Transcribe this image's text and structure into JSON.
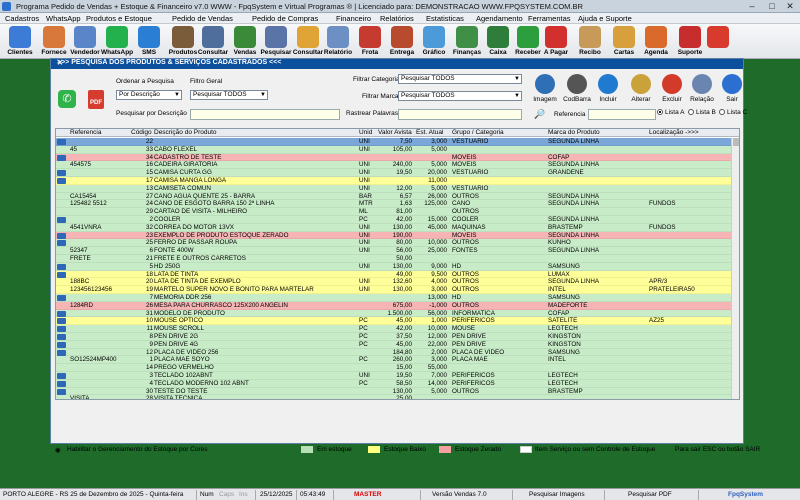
{
  "titlebar": {
    "title": "Programa Pedido de Vendas + Estoque & Financeiro v7.0 WWW - FpqSystem e Virtual Programas ® | Licenciado para: DEMONSTRACAO WWW.FPQSYSTEM.COM.BR"
  },
  "menu": [
    "Cadastros",
    "WhatsApp",
    "Produtos e Estoque",
    "Pedido de Vendas",
    "Pedido de Compras",
    "Financeiro",
    "Relatórios",
    "Estatisticas",
    "Agendamento",
    "Ferramentas",
    "Ajuda e Suporte"
  ],
  "toolbar": [
    {
      "label": "Clientes",
      "icon": "clients-icon",
      "color": "#3c7bd6"
    },
    {
      "label": "Fornece",
      "icon": "supplier-icon",
      "color": "#d8783a"
    },
    {
      "label": "Vendedor",
      "icon": "seller-icon",
      "color": "#5a86c9"
    },
    {
      "label": "WhatsApp",
      "icon": "whatsapp-icon",
      "color": "#22b14c"
    },
    {
      "label": "SMS",
      "icon": "sms-icon",
      "color": "#2a7fd4"
    },
    {
      "label": "Produtos",
      "icon": "products-icon",
      "color": "#7a5b3a"
    },
    {
      "label": "Consultar",
      "icon": "consult-icon",
      "color": "#4f6e9c"
    },
    {
      "label": "Vendas",
      "icon": "cart-icon",
      "color": "#3a8a3a"
    },
    {
      "label": "Pesquisar",
      "icon": "search-doc-icon",
      "color": "#5b74a8"
    },
    {
      "label": "Consultar",
      "icon": "consult-folder-icon",
      "color": "#e0a436"
    },
    {
      "label": "Relatório",
      "icon": "report-icon",
      "color": "#6c8fc4"
    },
    {
      "label": "Frota",
      "icon": "truck-icon",
      "color": "#c53b2f"
    },
    {
      "label": "Entrega",
      "icon": "delivery-icon",
      "color": "#b84a2e"
    },
    {
      "label": "Gráfico",
      "icon": "chart-icon",
      "color": "#4c9ad8"
    },
    {
      "label": "Finanças",
      "icon": "finance-icon",
      "color": "#3f8f47"
    },
    {
      "label": "Caixa",
      "icon": "cashier-icon",
      "color": "#2f7d3a"
    },
    {
      "label": "Receber",
      "icon": "receive-icon",
      "color": "#2c9e3e"
    },
    {
      "label": "A Pagar",
      "icon": "pay-icon",
      "color": "#d22f2f"
    },
    {
      "label": "Recibo",
      "icon": "receipt-icon",
      "color": "#c79a5a"
    },
    {
      "label": "Cartas",
      "icon": "letters-icon",
      "color": "#d7a03c"
    },
    {
      "label": "Agenda",
      "icon": "calendar-icon",
      "color": "#d96a2b"
    },
    {
      "label": "Suporte",
      "icon": "support-icon",
      "color": "#c72d2d"
    },
    {
      "label": "",
      "icon": "exit-icon",
      "color": "#d83a2e"
    }
  ],
  "window": {
    "title": ">>>  PESQUISA DOS PRODUTOS & SERVIÇOS CADASTRADOS  <<<",
    "ordenar_label": "Ordenar a Pesquisa",
    "ordenar_value": "Por Descrição",
    "filtro_geral_label": "Filtro Geral",
    "filtro_geral_value": "Pesquisar TODOS",
    "filtrar_categoria_label": "Filtrar Categoria",
    "filtrar_categoria_value": "Pesquisar TODOS",
    "filtrar_marca_label": "Filtrar Marca",
    "filtrar_marca_value": "Pesquisar TODOS",
    "pesquisar_descricao_label": "Pesquisar por Descrição",
    "rastrear_label": "Rastrear Palavras",
    "referencia_label": "Referencia",
    "buttons": [
      {
        "label": "Imagem",
        "icon": "image-icon",
        "color": "#2f6fb6"
      },
      {
        "label": "CodBarra",
        "icon": "barcode-icon",
        "color": "#555555"
      },
      {
        "label": "Incluir",
        "icon": "add-icon",
        "color": "#1f7ad0"
      },
      {
        "label": "Alterar",
        "icon": "edit-icon",
        "color": "#c9a23a"
      },
      {
        "label": "Excluir",
        "icon": "delete-icon",
        "color": "#d23a2a"
      },
      {
        "label": "Relação",
        "icon": "list-icon",
        "color": "#6a86b0"
      },
      {
        "label": "Sair",
        "icon": "exit-arrow-icon",
        "color": "#2b6fd0"
      }
    ],
    "radios": [
      {
        "label": "Lista A",
        "selected": true
      },
      {
        "label": "Lista B",
        "selected": false
      },
      {
        "label": "Lista C",
        "selected": false
      }
    ]
  },
  "table": {
    "columns": [
      "Referencia",
      "Código",
      "Descrição do Produto",
      "Unid",
      "Valor Avista",
      "Est. Atual",
      "Grupo / Categoria",
      "Marca do Produto",
      "Localização  ->>>"
    ],
    "rows": [
      {
        "mk": true,
        "ref": "",
        "cod": "22",
        "desc": "",
        "unid": "UNI",
        "valor": "7,50",
        "est": "3,000",
        "grupo": "VESTUARIO",
        "marca": "SEGUNDA LINHA",
        "loc": "",
        "status": "sel"
      },
      {
        "mk": false,
        "ref": "45",
        "cod": "33",
        "desc": "CABO FLEXEL",
        "unid": "UNI",
        "valor": "105,00",
        "est": "5,000",
        "grupo": "",
        "marca": "",
        "loc": "",
        "status": "ok"
      },
      {
        "mk": true,
        "ref": "",
        "cod": "34",
        "desc": "CADASTRO DE TESTE",
        "unid": "",
        "valor": "",
        "est": "",
        "grupo": "MOVEIS",
        "marca": "COFAP",
        "loc": "",
        "status": "zero"
      },
      {
        "mk": false,
        "ref": "454575",
        "cod": "16",
        "desc": "CADEIRA GIRATORIA",
        "unid": "UNI",
        "valor": "240,00",
        "est": "5,000",
        "grupo": "MOVEIS",
        "marca": "SEGUNDA LINHA",
        "loc": "",
        "status": "ok"
      },
      {
        "mk": true,
        "ref": "",
        "cod": "15",
        "desc": "CAMISA CURTA GG",
        "unid": "UNI",
        "valor": "19,50",
        "est": "20,000",
        "grupo": "VESTUARIO",
        "marca": "GRANDENE",
        "loc": "",
        "status": "ok"
      },
      {
        "mk": true,
        "ref": "",
        "cod": "17",
        "desc": "CAMISA MANGA LONGA",
        "unid": "UNI",
        "valor": "",
        "est": "11,000",
        "grupo": "",
        "marca": "",
        "loc": "",
        "status": "low"
      },
      {
        "mk": false,
        "ref": "",
        "cod": "13",
        "desc": "CAMISETA COMUN",
        "unid": "UNI",
        "valor": "12,00",
        "est": "5,000",
        "grupo": "VESTUARIO",
        "marca": "",
        "loc": "",
        "status": "ok"
      },
      {
        "mk": false,
        "ref": "CA15454",
        "cod": "27",
        "desc": "CANO AGUA QUENTE 25 - BARRA",
        "unid": "BAR",
        "valor": "6,57",
        "est": "26,000",
        "grupo": "OUTROS",
        "marca": "SEGUNDA LINHA",
        "loc": "",
        "status": "ok"
      },
      {
        "mk": false,
        "ref": "125482 5512",
        "cod": "24",
        "desc": "CANO DE ESGOTO BARRA 150 2ª LINHA",
        "unid": "MTR",
        "valor": "1,63",
        "est": "125,000",
        "grupo": "CANO",
        "marca": "SEGUNDA LINHA",
        "loc": "FUNDOS",
        "status": "ok"
      },
      {
        "mk": false,
        "ref": "",
        "cod": "29",
        "desc": "CARTAO DE VISITA - MILHEIRO",
        "unid": "ML",
        "valor": "81,00",
        "est": "",
        "grupo": "OUTROS",
        "marca": "",
        "loc": "",
        "status": "ok"
      },
      {
        "mk": true,
        "ref": "",
        "cod": "2",
        "desc": "COOLER",
        "unid": "PC",
        "valor": "42,00",
        "est": "15,000",
        "grupo": "COOLER",
        "marca": "SEGUNDA LINHA",
        "loc": "",
        "status": "ok"
      },
      {
        "mk": false,
        "ref": "4541VNRA",
        "cod": "32",
        "desc": "CORREA DO MOTOR 13VX",
        "unid": "UNI",
        "valor": "130,00",
        "est": "45,000",
        "grupo": "MAQUINAS",
        "marca": "BRASTEMP",
        "loc": "FUNDOS",
        "status": "ok"
      },
      {
        "mk": true,
        "ref": "",
        "cod": "23",
        "desc": "EXEMPLO DE PRODUTO ESTOQUE ZERADO",
        "unid": "UNI",
        "valor": "190,00",
        "est": "",
        "grupo": "MOVEIS",
        "marca": "SEGUNDA LINHA",
        "loc": "",
        "status": "zero"
      },
      {
        "mk": true,
        "ref": "",
        "cod": "25",
        "desc": "FERRO DE PASSAR ROUPA",
        "unid": "UNI",
        "valor": "80,00",
        "est": "10,000",
        "grupo": "OUTROS",
        "marca": "KUNHO",
        "loc": "",
        "status": "ok"
      },
      {
        "mk": false,
        "ref": "52347",
        "cod": "6",
        "desc": "FONTE 400W",
        "unid": "UNI",
        "valor": "56,00",
        "est": "25,000",
        "grupo": "FONTES",
        "marca": "SEGUNDA LINHA",
        "loc": "",
        "status": "ok"
      },
      {
        "mk": false,
        "ref": "FRETE",
        "cod": "21",
        "desc": "FRETE E OUTROS CARRETOS",
        "unid": "",
        "valor": "50,00",
        "est": "",
        "grupo": "",
        "marca": "",
        "loc": "",
        "status": "ok"
      },
      {
        "mk": true,
        "ref": "",
        "cod": "5",
        "desc": "HD 250G",
        "unid": "UNI",
        "valor": "130,00",
        "est": "9,000",
        "grupo": "HD",
        "marca": "SAMSUNG",
        "loc": "",
        "status": "ok"
      },
      {
        "mk": true,
        "ref": "",
        "cod": "18",
        "desc": "LATA DE TINTA",
        "unid": "",
        "valor": "49,00",
        "est": "9,500",
        "grupo": "OUTROS",
        "marca": "LUMAX",
        "loc": "",
        "status": "low"
      },
      {
        "mk": false,
        "ref": "188BC",
        "cod": "20",
        "desc": "LATA DE TINTA DE EXEMPLO",
        "unid": "UNI",
        "valor": "132,60",
        "est": "4,000",
        "grupo": "OUTROS",
        "marca": "SEGUNDA LINHA",
        "loc": "APR/3",
        "status": "low"
      },
      {
        "mk": false,
        "ref": "123456123456",
        "cod": "19",
        "desc": "MARTELO SUPER NOVO E BONITO PARA MARTELAR",
        "unid": "UNI",
        "valor": "130,00",
        "est": "3,000",
        "grupo": "OUTROS",
        "marca": "INTEL",
        "loc": "PRATELEIRA50",
        "status": "low"
      },
      {
        "mk": true,
        "ref": "",
        "cod": "7",
        "desc": "MEMORIA DDR 256",
        "unid": "",
        "valor": "",
        "est": "13,000",
        "grupo": "HD",
        "marca": "SAMSUNG",
        "loc": "",
        "status": "ok"
      },
      {
        "mk": false,
        "ref": "1284RD",
        "cod": "26",
        "desc": "MESA PARA CHURRASCO 125X200 ANGELIN",
        "unid": "",
        "valor": "675,00",
        "est": "-1,000",
        "grupo": "OUTROS",
        "marca": "MADEFORTE",
        "loc": "",
        "status": "zero"
      },
      {
        "mk": true,
        "ref": "",
        "cod": "31",
        "desc": "MODELO DE PRODUTO",
        "unid": "",
        "valor": "1.500,00",
        "est": "56,000",
        "grupo": "INFORMATICA",
        "marca": "COFAP",
        "loc": "",
        "status": "ok"
      },
      {
        "mk": true,
        "ref": "",
        "cod": "10",
        "desc": "MOUSE OPTICO",
        "unid": "PC",
        "valor": "45,00",
        "est": "1,000",
        "grupo": "PERIFERICOS",
        "marca": "SATELITE",
        "loc": "AZ25",
        "status": "low"
      },
      {
        "mk": true,
        "ref": "",
        "cod": "11",
        "desc": "MOUSE SCROLL",
        "unid": "PC",
        "valor": "42,00",
        "est": "10,000",
        "grupo": "MOUSE",
        "marca": "LEGTECH",
        "loc": "",
        "status": "ok"
      },
      {
        "mk": true,
        "ref": "",
        "cod": "8",
        "desc": "PEN DRIVE 2G",
        "unid": "PC",
        "valor": "37,50",
        "est": "12,000",
        "grupo": "PEN DRIVE",
        "marca": "KINGSTON",
        "loc": "",
        "status": "ok"
      },
      {
        "mk": true,
        "ref": "",
        "cod": "9",
        "desc": "PEN DRIVE 4G",
        "unid": "PC",
        "valor": "45,00",
        "est": "22,000",
        "grupo": "PEN DRIVE",
        "marca": "KINGSTON",
        "loc": "",
        "status": "ok"
      },
      {
        "mk": true,
        "ref": "",
        "cod": "12",
        "desc": "PLACA DE VIDEO 256",
        "unid": "",
        "valor": "184,80",
        "est": "2,000",
        "grupo": "PLACA DE VIDEO",
        "marca": "SAMSUNG",
        "loc": "",
        "status": "ok"
      },
      {
        "mk": false,
        "ref": "SO12524MP400",
        "cod": "1",
        "desc": "PLACA MÃE SOYO",
        "unid": "PC",
        "valor": "260,00",
        "est": "3,000",
        "grupo": "PLACA MÃE",
        "marca": "INTEL",
        "loc": "",
        "status": "ok"
      },
      {
        "mk": false,
        "ref": "",
        "cod": "14",
        "desc": "PREGO VERMELHO",
        "unid": "",
        "valor": "15,00",
        "est": "55,000",
        "grupo": "",
        "marca": "",
        "loc": "",
        "status": "ok"
      },
      {
        "mk": true,
        "ref": "",
        "cod": "3",
        "desc": "TECLADO 102ABNT",
        "unid": "UNI",
        "valor": "19,50",
        "est": "7,000",
        "grupo": "PERIFERICOS",
        "marca": "LEGTECH",
        "loc": "",
        "status": "ok"
      },
      {
        "mk": true,
        "ref": "",
        "cod": "4",
        "desc": "TECLADO MODERNO 102 ABNT",
        "unid": "PC",
        "valor": "58,50",
        "est": "14,000",
        "grupo": "PERIFERICOS",
        "marca": "LEGTECH",
        "loc": "",
        "status": "ok"
      },
      {
        "mk": true,
        "ref": "",
        "cod": "30",
        "desc": "TESTE DO TESTE",
        "unid": "",
        "valor": "130,00",
        "est": "5,000",
        "grupo": "OUTROS",
        "marca": "BRASTEMP",
        "loc": "",
        "status": "ok"
      },
      {
        "mk": false,
        "ref": "VISITA",
        "cod": "28",
        "desc": "VISITA TÉCNICA",
        "unid": "",
        "valor": "25,00",
        "est": "",
        "grupo": "",
        "marca": "",
        "loc": "",
        "status": "ok"
      }
    ]
  },
  "legend": {
    "toggle_label": "Habilitar o Gerenciamento do Estoque por Cores",
    "items": [
      {
        "label": "Em estoque",
        "color": "#b8e0b8"
      },
      {
        "label": "Estoque Baixo",
        "color": "#ffff80"
      },
      {
        "label": "Estoque Zerado",
        "color": "#f4a0a0"
      },
      {
        "label": "Item Serviço ou sem Controle de Estoque",
        "color": "#ffffff"
      }
    ],
    "exit_hint": "Para sair ESC ou botão SAIR"
  },
  "status": [
    "PORTO ALEGRE - RS 25 de Dezembro de 2025 - Quinta-feira",
    "Num",
    "Caps",
    "Ins",
    "25/12/2025",
    "05:43:49",
    "MASTER",
    "Versão Vendas 7.0",
    "Pesquisar Imagens",
    "Pesquisar PDF",
    "FpqSystem"
  ],
  "colors": {
    "em_estoque": "#c8ecc8",
    "estoque_baixo": "#ffff99",
    "estoque_zerado": "#f6b4b4",
    "selected": "#7aa7d8"
  }
}
